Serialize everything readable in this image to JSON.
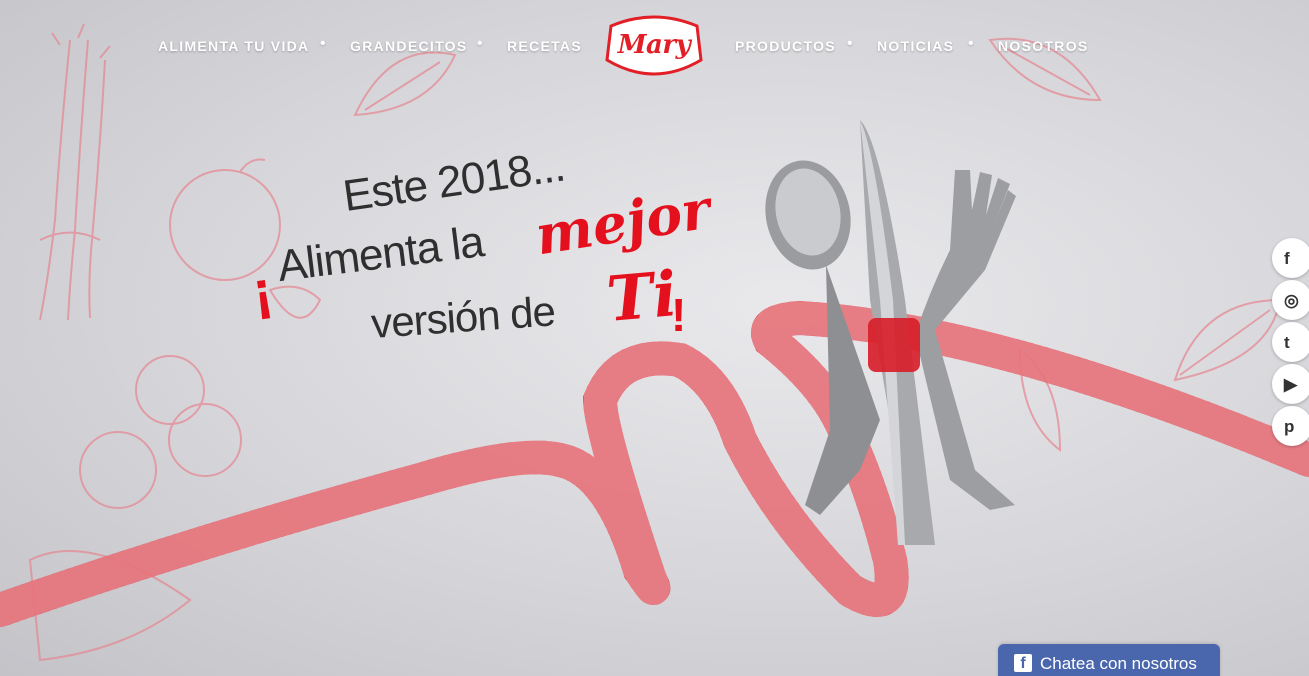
{
  "nav": {
    "left_items": [
      "ALIMENTA TU VIDA",
      "GRANDECITOS",
      "RECETAS"
    ],
    "right_items": [
      "PRODUCTOS",
      "NOTICIAS",
      "NOSOTROS"
    ],
    "separator": "•"
  },
  "logo": {
    "text": "Mary",
    "brand_color": "#e21f26"
  },
  "headline": {
    "line1": "Este 2018...",
    "excl_open": "¡",
    "line2": "Alimenta la",
    "accent1": "mejor",
    "line3": "versión de",
    "accent2": "Ti",
    "excl_close": "!",
    "accent_color": "#e5101d"
  },
  "social": {
    "items": [
      {
        "icon": "facebook-icon",
        "glyph": "f"
      },
      {
        "icon": "instagram-icon",
        "glyph": "◎"
      },
      {
        "icon": "twitter-icon",
        "glyph": "t"
      },
      {
        "icon": "youtube-icon",
        "glyph": "▶"
      },
      {
        "icon": "pinterest-icon",
        "glyph": "p"
      }
    ]
  },
  "chat": {
    "label": "Chatea con nosotros",
    "icon": "facebook-icon",
    "icon_glyph": "f",
    "color": "#4a67ad"
  }
}
